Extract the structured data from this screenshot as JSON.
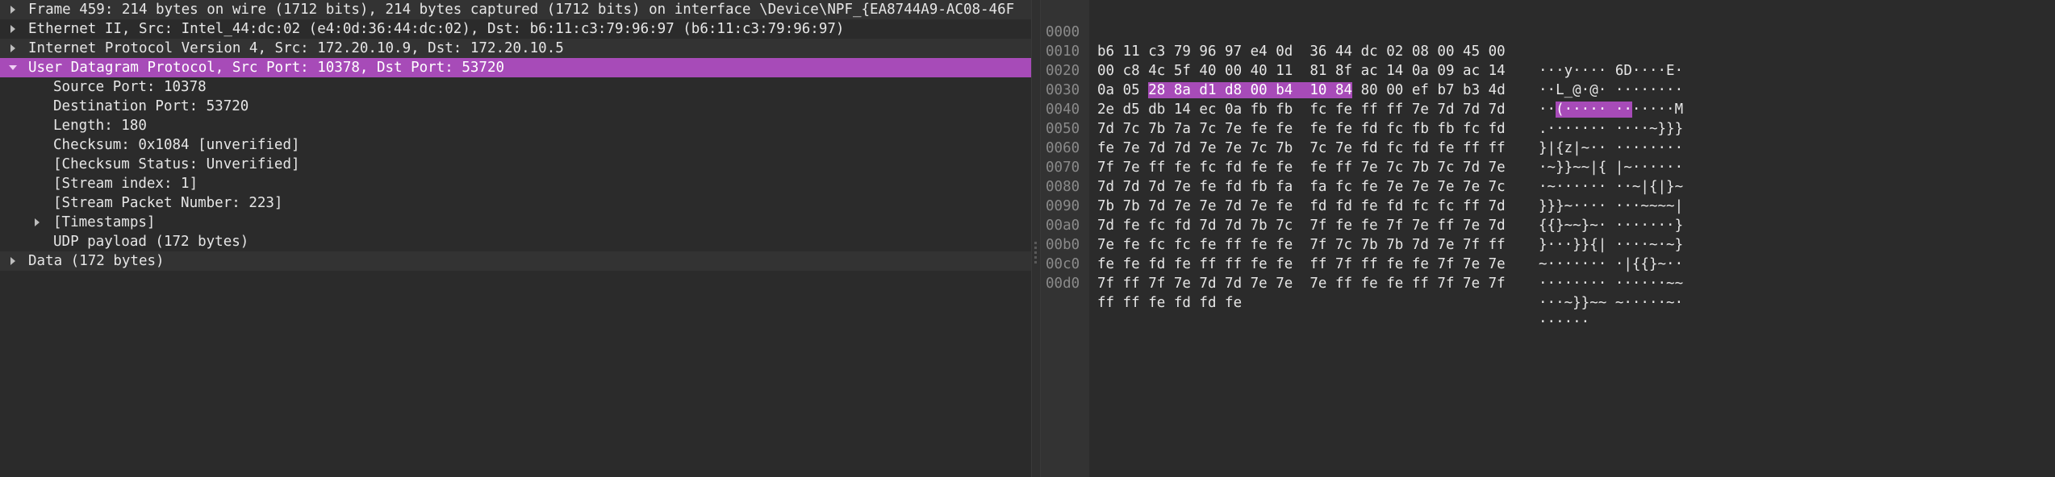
{
  "details": {
    "rows": [
      {
        "text": "Frame 459: 214 bytes on wire (1712 bits), 214 bytes captured (1712 bits) on interface \\Device\\NPF_{EA8744A9-AC08-46F",
        "expanded": false
      },
      {
        "text": "Ethernet II, Src: Intel_44:dc:02 (e4:0d:36:44:dc:02), Dst: b6:11:c3:79:96:97 (b6:11:c3:79:96:97)",
        "expanded": false
      },
      {
        "text": "Internet Protocol Version 4, Src: 172.20.10.9, Dst: 172.20.10.5",
        "expanded": false
      },
      {
        "text": "User Datagram Protocol, Src Port: 10378, Dst Port: 53720",
        "expanded": true
      }
    ],
    "udp_children": [
      "Source Port: 10378",
      "Destination Port: 53720",
      "Length: 180",
      "Checksum: 0x1084 [unverified]",
      "[Checksum Status: Unverified]",
      "[Stream index: 1]",
      "[Stream Packet Number: 223]",
      "[Timestamps]",
      "UDP payload (172 bytes)"
    ],
    "data_row": "Data (172 bytes)"
  },
  "bytes": {
    "rows": [
      {
        "offset": "0000",
        "hex": "b6 11 c3 79 96 97 e4 0d  36 44 dc 02 08 00 45 00",
        "ascii": "···y···· 6D····E·"
      },
      {
        "offset": "0010",
        "hex": "00 c8 4c 5f 40 00 40 11  81 8f ac 14 0a 09 ac 14",
        "ascii": "··L_@·@· ········"
      },
      {
        "offset": "0020",
        "hex_pre": "0a 05 ",
        "hex_hl": "28 8a d1 d8 00 b4  10 84",
        "hex_post": " 80 00 ef b7 b3 4d",
        "ascii_pre": "··",
        "ascii_hl": "(····· ··",
        "ascii_post": "·····M"
      },
      {
        "offset": "0030",
        "hex": "2e d5 db 14 ec 0a fb fb  fc fe ff ff 7e 7d 7d 7d",
        "ascii": ".······· ····~}}}"
      },
      {
        "offset": "0040",
        "hex": "7d 7c 7b 7a 7c 7e fe fe  fe fe fd fc fb fb fc fd",
        "ascii": "}|{z|~·· ········"
      },
      {
        "offset": "0050",
        "hex": "fe 7e 7d 7d 7e 7e 7c 7b  7c 7e fd fc fd fe ff ff",
        "ascii": "·~}}~~|{ |~······"
      },
      {
        "offset": "0060",
        "hex": "7f 7e ff fe fc fd fe fe  fe ff 7e 7c 7b 7c 7d 7e",
        "ascii": "·~······ ··~|{|}~"
      },
      {
        "offset": "0070",
        "hex": "7d 7d 7d 7e fe fd fb fa  fa fc fe 7e 7e 7e 7e 7c",
        "ascii": "}}}~···· ···~~~~|"
      },
      {
        "offset": "0080",
        "hex": "7b 7b 7d 7e 7e 7d 7e fe  fd fd fe fd fc fc ff 7d",
        "ascii": "{{}~~}~· ·······}"
      },
      {
        "offset": "0090",
        "hex": "7d fe fc fd 7d 7d 7b 7c  7f fe fe 7f 7e ff 7e 7d",
        "ascii": "}···}}{| ····~·~}"
      },
      {
        "offset": "00a0",
        "hex": "7e fe fc fc fe ff fe fe  7f 7c 7b 7b 7d 7e 7f ff",
        "ascii": "~······· ·|{{}~··"
      },
      {
        "offset": "00b0",
        "hex": "fe fe fd fe ff ff fe fe  ff 7f ff fe fe 7f 7e 7e",
        "ascii": "········ ······~~"
      },
      {
        "offset": "00c0",
        "hex": "7f ff 7f 7e 7d 7d 7e 7e  7e ff fe fe ff 7f 7e 7f",
        "ascii": "···~}}~~ ~·····~·"
      },
      {
        "offset": "00d0",
        "hex": "ff ff fe fd fd fe",
        "ascii": "······"
      }
    ]
  },
  "colors": {
    "selection": "#a74bb8",
    "background": "#2b2b2b",
    "alt_row": "#333333"
  }
}
